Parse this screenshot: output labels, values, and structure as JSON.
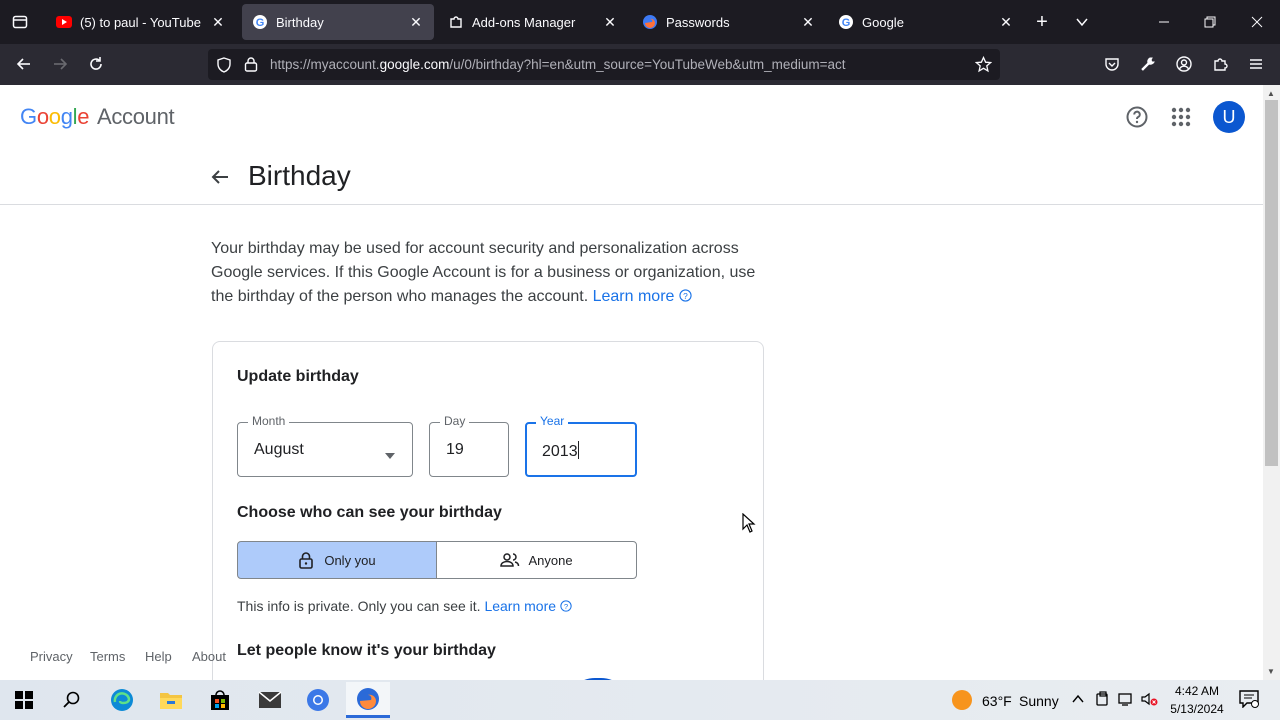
{
  "tabs": [
    {
      "title": "(5) to paul - YouTube",
      "icon": "youtube-icon"
    },
    {
      "title": "Birthday",
      "icon": "google-icon",
      "active": true
    },
    {
      "title": "Add-ons Manager",
      "icon": "puzzle-icon"
    },
    {
      "title": "Passwords",
      "icon": "firefox-icon"
    },
    {
      "title": "Google",
      "icon": "google-icon"
    }
  ],
  "nav": {
    "url_prefix": "https://myaccount.",
    "url_domain": "google.com",
    "url_suffix": "/u/0/birthday?hl=en&utm_source=YouTubeWeb&utm_medium=act"
  },
  "header": {
    "logo_google": "Google",
    "logo_account": "Account",
    "avatar_letter": "U"
  },
  "page": {
    "title": "Birthday",
    "description": "Your birthday may be used for account security and personalization across Google services. If this Google Account is for a business or organization, use the birthday of the person who manages the account.",
    "learn_more": "Learn more"
  },
  "card": {
    "heading": "Update birthday",
    "month_label": "Month",
    "month_value": "August",
    "day_label": "Day",
    "day_value": "19",
    "year_label": "Year",
    "year_value": "2013",
    "visibility_heading": "Choose who can see your birthday",
    "option_only_you": "Only you",
    "option_anyone": "Anyone",
    "private_note": "This info is private. Only you can see it.",
    "private_learn_more": "Learn more",
    "let_people_heading": "Let people know it's your birthday"
  },
  "footer": {
    "links": [
      "Privacy",
      "Terms",
      "Help",
      "About"
    ]
  },
  "taskbar": {
    "weather_temp": "63°F",
    "weather_cond": "Sunny",
    "time": "4:42 AM",
    "date": "5/13/2024"
  },
  "colors": {
    "accent": "#1a73e8",
    "avatar_bg": "#0b57d0",
    "selected_segment_bg": "#aecbfa"
  }
}
